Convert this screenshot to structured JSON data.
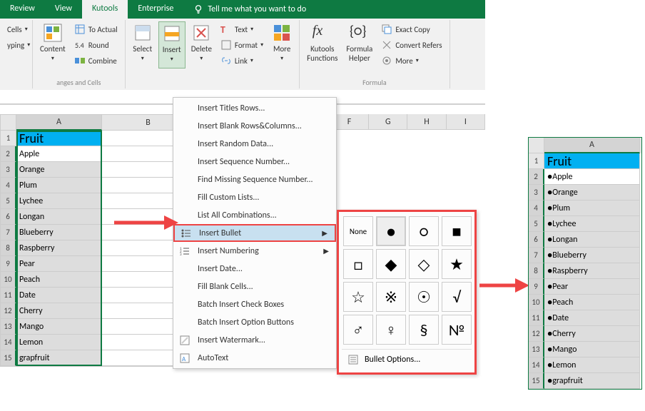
{
  "tabs": {
    "review": "Review",
    "view": "View",
    "kutools": "Kutools",
    "enterprise": "Enterprise",
    "tell_me": "Tell me what you want to do"
  },
  "ribbon": {
    "cells_label": "Cells",
    "typing_label": "yping",
    "to_actual": "To Actual",
    "round": "Round",
    "combine": "Combine",
    "content": "Content",
    "select": "Select",
    "insert": "Insert",
    "delete": "Delete",
    "text": "Text",
    "format": "Format",
    "link": "Link",
    "more": "More",
    "kutools_functions": "Kutools\nFunctions",
    "formula_helper": "Formula\nHelper",
    "exact_copy": "Exact Copy",
    "convert_refers": "Convert Refers",
    "more2": "More",
    "group_ranges": "anges and Cells",
    "group_formula": "Formula"
  },
  "sheet1": {
    "cols": [
      "A",
      "B"
    ],
    "header": "Fruit",
    "rows": [
      "Apple",
      "Orange",
      "Plum",
      "Lychee",
      "Longan",
      "Blueberry",
      "Raspberry",
      "Pear",
      "Peach",
      "Date",
      "Cherry",
      "Mango",
      "Lemon",
      "grapfruit"
    ]
  },
  "sheet2": {
    "cols": [
      "A"
    ],
    "header": "Fruit",
    "rows": [
      "●Apple",
      "●Orange",
      "●Plum",
      "●Lychee",
      "●Longan",
      "●Blueberry",
      "●Raspberry",
      "●Pear",
      "●Peach",
      "●Date",
      "●Cherry",
      "●Mango",
      "●Lemon",
      "●grapfruit"
    ]
  },
  "menu": {
    "items": [
      "Insert Titles Rows...",
      "Insert Blank Rows&Columns...",
      "Insert Random Data...",
      "Insert Sequence Number...",
      "Find Missing Sequence Number...",
      "Fill Custom Lists...",
      "List All Combinations...",
      "Insert Bullet",
      "Insert Numbering",
      "Insert Date...",
      "Fill Blank Cells...",
      "Batch Insert Check Boxes",
      "Batch Insert Option Buttons",
      "Insert Watermark...",
      "AutoText"
    ]
  },
  "bullets": {
    "none": "None",
    "options": "Bullet Options...",
    "symbols": [
      "●",
      "○",
      "■",
      "□",
      "◆",
      "◇",
      "★",
      "☆",
      "※",
      "☉",
      "√",
      "♂",
      "♀",
      "§",
      "№"
    ]
  },
  "chart_data": {
    "type": "table",
    "title": "Fruit",
    "categories": [
      "Apple",
      "Orange",
      "Plum",
      "Lychee",
      "Longan",
      "Blueberry",
      "Raspberry",
      "Pear",
      "Peach",
      "Date",
      "Cherry",
      "Mango",
      "Lemon",
      "grapfruit"
    ]
  }
}
